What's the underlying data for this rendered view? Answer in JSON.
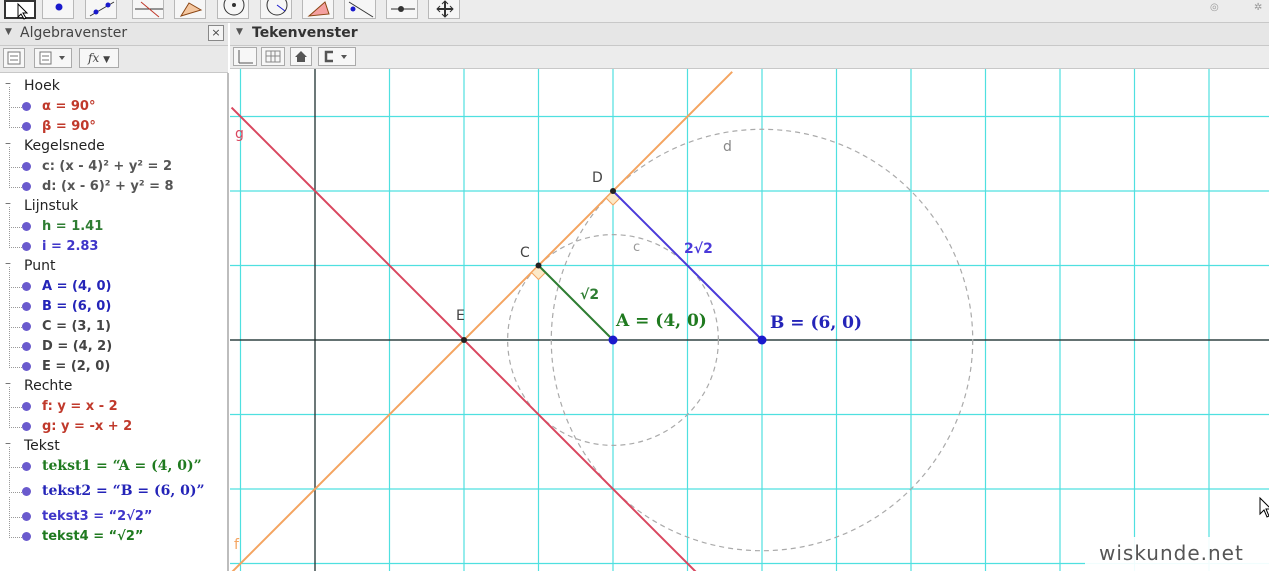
{
  "toolbar": {
    "tools": [
      "move-tool",
      "point-tool",
      "line-tool",
      "perpendicular-line-tool",
      "polygon-tool",
      "circle-tool",
      "circle-center-radius-tool",
      "angle-tool",
      "reflect-tool",
      "slider-tool",
      "move-view-tool"
    ],
    "active": "move-tool"
  },
  "algebra": {
    "title": "Algebravenster",
    "close": "×",
    "input_tool_label": "fx",
    "groups": [
      {
        "name": "Hoek",
        "items": [
          {
            "text": "α = 90°",
            "color": "#c0392b"
          },
          {
            "text": "β = 90°",
            "color": "#c0392b"
          }
        ]
      },
      {
        "name": "Kegelsnede",
        "items": [
          {
            "text": "c: (x - 4)² + y² = 2",
            "color": "#555555"
          },
          {
            "text": "d: (x - 6)² + y² = 8",
            "color": "#555555"
          }
        ]
      },
      {
        "name": "Lijnstuk",
        "items": [
          {
            "text": "h = 1.41",
            "color": "#2e7d32"
          },
          {
            "text": "i = 2.83",
            "color": "#3f36c9"
          }
        ]
      },
      {
        "name": "Punt",
        "items": [
          {
            "text": "A = (4, 0)",
            "color": "#2424b8"
          },
          {
            "text": "B = (6, 0)",
            "color": "#2424b8"
          },
          {
            "text": "C = (3, 1)",
            "color": "#444444"
          },
          {
            "text": "D = (4, 2)",
            "color": "#444444"
          },
          {
            "text": "E = (2, 0)",
            "color": "#444444"
          }
        ]
      },
      {
        "name": "Rechte",
        "items": [
          {
            "text": "f: y = x - 2",
            "color": "#c0392b"
          },
          {
            "text": "g: y = -x + 2",
            "color": "#c0392b"
          }
        ]
      },
      {
        "name": "Tekst",
        "items": [
          {
            "text": "tekst1 =  “A = (4, 0)”",
            "color": "#1f7a1f",
            "serif": true
          },
          {
            "text": "tekst2 =  “B = (6, 0)”",
            "color": "#2424b8",
            "serif": true
          },
          {
            "text": "tekst3 = “2√2”",
            "color": "#3f36c9"
          },
          {
            "text": "tekst4 = “√2”",
            "color": "#1f7a1f"
          }
        ]
      }
    ]
  },
  "graphics": {
    "title": "Tekenvenster",
    "labels": {
      "g": "g",
      "f": "f",
      "d": "d",
      "c": "c",
      "D": "D",
      "C": "C",
      "E": "E",
      "text_A": "A = (4, 0)",
      "text_B": "B = (6, 0)",
      "seg_h": "√2",
      "seg_i": "2√2"
    },
    "colors": {
      "grid": "#4fe0e0",
      "axis": "#222222",
      "line_f": "#f4a460",
      "line_g": "#d9475f",
      "seg_h": "#2e7d32",
      "seg_i": "#4b3ad9",
      "circle": "#aaaaaa",
      "point_AB": "#1a1acc",
      "point_other": "#222222",
      "text_A": "#1f7a1f",
      "text_B": "#2424b8"
    }
  },
  "watermark": "wiskunde.net"
}
